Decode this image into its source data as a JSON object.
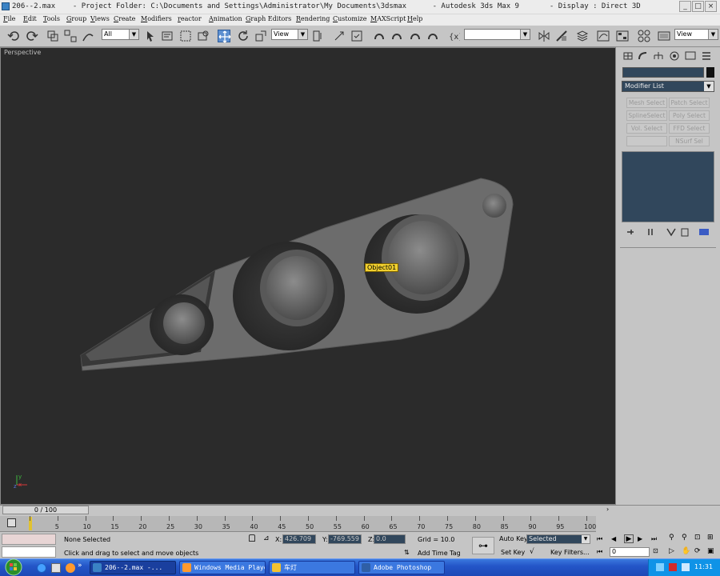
{
  "window": {
    "title": "206--2.max    - Project Folder: C:\\Documents and Settings\\Administrator\\My Documents\\3dsmax      - Autodesk 3ds Max 9       - Display : Direct 3D",
    "minimize": "_",
    "maximize": "□",
    "close": "×"
  },
  "menu": [
    "File",
    "Edit",
    "Tools",
    "Group",
    "Views",
    "Create",
    "Modifiers",
    "reactor",
    "Animation",
    "Graph Editors",
    "Rendering",
    "Customize",
    "MAXScript",
    "Help"
  ],
  "toolbar": {
    "filter_select": "All",
    "coord_select": "View",
    "right_select": "View",
    "named_sel_empty": ""
  },
  "viewport": {
    "label": "Perspective",
    "object_label": "Object01",
    "axis_x": "x",
    "axis_y": "y",
    "axis_z": "z",
    "background": "#2b2b2b",
    "mesh_color": "#6e6e6e"
  },
  "command_panel": {
    "object_name": "",
    "modifier_list": "Modifier List",
    "buttons": [
      "Mesh Select",
      "Patch Select",
      "SplineSelect",
      "Poly Select",
      "Vol. Select",
      "FFD Select",
      "",
      "NSurf Sel"
    ]
  },
  "timeline": {
    "slider": "0 / 100",
    "ticks": [
      "0",
      "5",
      "10",
      "15",
      "20",
      "25",
      "30",
      "35",
      "40",
      "45",
      "50",
      "55",
      "60",
      "65",
      "70",
      "75",
      "80",
      "85",
      "90",
      "95",
      "100"
    ]
  },
  "status": {
    "selection": "None Selected",
    "prompt": "Click and drag to select and move objects",
    "x_label": "X:",
    "x_value": "426.709",
    "y_label": "Y:",
    "y_value": "-769.559",
    "z_label": "Z:",
    "z_value": "0.0",
    "grid": "Grid = 10.0",
    "add_time_tag": "Add Time Tag",
    "auto_key": "Auto Key",
    "set_key": "Set Key",
    "selected_dropdown": "Selected",
    "key_filters": "Key Filters...",
    "frame_value": "0"
  },
  "taskbar": {
    "tasks": [
      "206--2.max        -...",
      "Windows Media Player",
      "车灯",
      "Adobe Photoshop"
    ],
    "clock": "11:31"
  }
}
